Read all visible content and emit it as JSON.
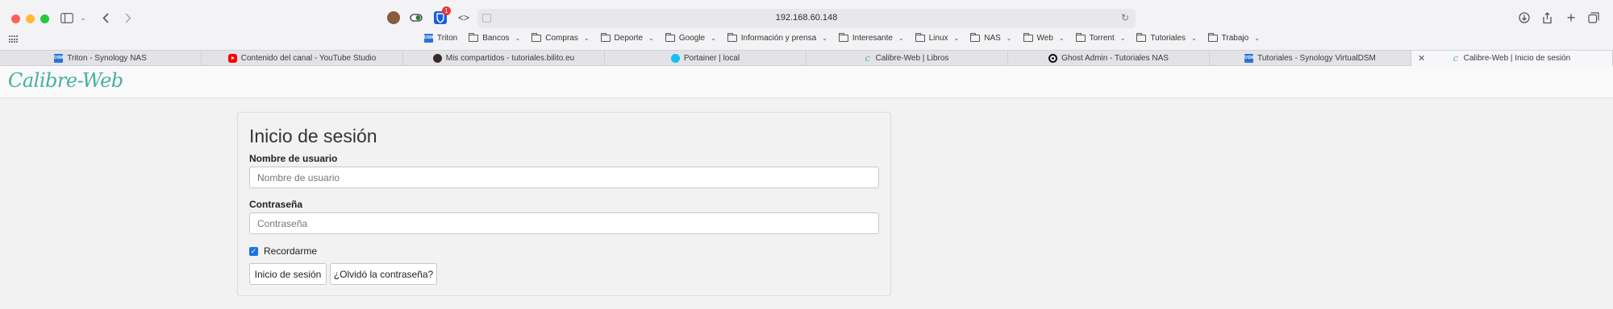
{
  "browser": {
    "url": "192.168.60.148",
    "extension_badge": "1",
    "colors": {
      "close": "#fe5f57",
      "minimize": "#febc2e",
      "maximize": "#28c840",
      "badge": "#e33333"
    }
  },
  "bookmarks": [
    {
      "label": "Triton",
      "type": "site"
    },
    {
      "label": "Bancos",
      "type": "folder"
    },
    {
      "label": "Compras",
      "type": "folder"
    },
    {
      "label": "Deporte",
      "type": "folder"
    },
    {
      "label": "Google",
      "type": "folder"
    },
    {
      "label": "Información y prensa",
      "type": "folder"
    },
    {
      "label": "Interesante",
      "type": "folder"
    },
    {
      "label": "Linux",
      "type": "folder"
    },
    {
      "label": "NAS",
      "type": "folder"
    },
    {
      "label": "Web",
      "type": "folder"
    },
    {
      "label": "Torrent",
      "type": "folder"
    },
    {
      "label": "Tutoriales",
      "type": "folder"
    },
    {
      "label": "Trabajo",
      "type": "folder"
    }
  ],
  "tabs": [
    {
      "label": "Triton - Synology NAS",
      "icon": "dsm-icon"
    },
    {
      "label": "Contenido del canal - YouTube Studio",
      "icon": "youtube-icon"
    },
    {
      "label": "Mis compartidos - tutoriales.bilito.eu",
      "icon": "site-icon"
    },
    {
      "label": "Portainer | local",
      "icon": "portainer-icon"
    },
    {
      "label": "Calibre-Web | Libros",
      "icon": "calibre-icon"
    },
    {
      "label": "Ghost Admin - Tutoriales NAS",
      "icon": "ghost-icon"
    },
    {
      "label": "Tutoriales - Synology VirtualDSM",
      "icon": "dsm-icon"
    },
    {
      "label": "Calibre-Web | Inicio de sesión",
      "icon": "calibre-icon",
      "active": true
    }
  ],
  "app": {
    "logo": "Calibre-Web",
    "accent_color": "#45b29d"
  },
  "login": {
    "title": "Inicio de sesión",
    "username_label": "Nombre de usuario",
    "username_placeholder": "Nombre de usuario",
    "password_label": "Contraseña",
    "password_placeholder": "Contraseña",
    "remember_label": "Recordarme",
    "remember_checked": true,
    "submit_label": "Inicio de sesión",
    "forgot_label": "¿Olvidó la contraseña?"
  }
}
